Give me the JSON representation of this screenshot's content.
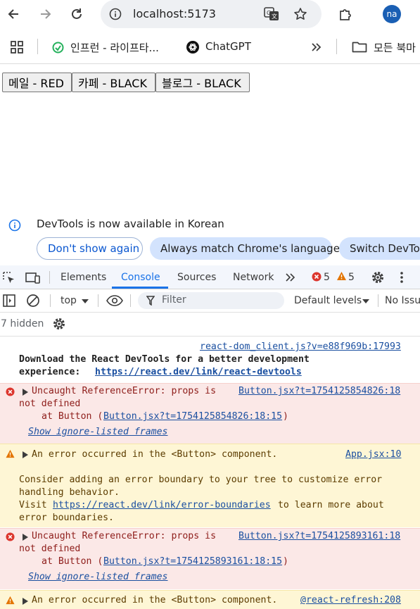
{
  "browser": {
    "url": "localhost:5173",
    "profile_initials": "na",
    "bookmarks": [
      {
        "label": "인프런 - 라이프타..."
      },
      {
        "label": "ChatGPT"
      },
      {
        "label": "모든 북마"
      }
    ]
  },
  "page": {
    "buttons": [
      {
        "label": "메일 - RED"
      },
      {
        "label": "카페 - BLACK"
      },
      {
        "label": "블로그 - BLACK"
      }
    ]
  },
  "devtools_notice": {
    "message": "DevTools is now available in Korean",
    "dont_show": "Don't show again",
    "always_match": "Always match Chrome's language",
    "switch": "Switch DevToo"
  },
  "devtools": {
    "tabs": [
      {
        "label": "Elements"
      },
      {
        "label": "Console"
      },
      {
        "label": "Sources"
      },
      {
        "label": "Network"
      }
    ],
    "error_count": "5",
    "warning_count": "5",
    "context": "top",
    "filter_placeholder": "Filter",
    "levels": "Default levels",
    "issues": "No Issu",
    "hidden": "7 hidden"
  },
  "console": {
    "info_source": "react-dom_client.js?v=e88f969b:17993",
    "info_line1": "Download the React DevTools for a better development",
    "info_line2_prefix": "experience: ",
    "info_link": "https://react.dev/link/react-devtools",
    "err1": {
      "line1": "Uncaught ReferenceError: props is",
      "line2": "not defined",
      "source": "Button.jsx?t=1754125854826:18",
      "at_prefix": "at Button (",
      "at_link": "Button.jsx?t=1754125854826:18:15",
      "at_suffix": ")",
      "ignore": "Show ignore-listed frames"
    },
    "warn1": {
      "line1": "An error occurred in the <Button> component.",
      "source": "App.jsx:10",
      "body1": "Consider adding an error boundary to your tree to customize error",
      "body2": "handling behavior.",
      "visit": "Visit ",
      "link": "https://react.dev/link/error-boundaries",
      "tail": " to learn more about",
      "body4": "error boundaries."
    },
    "err2": {
      "line1": "Uncaught ReferenceError: props is",
      "line2": "not defined",
      "source": "Button.jsx?t=1754125893161:18",
      "at_prefix": "at Button (",
      "at_link": "Button.jsx?t=1754125893161:18:15",
      "at_suffix": ")",
      "ignore": "Show ignore-listed frames"
    },
    "warn2": {
      "line1": "An error occurred in the <Button> component.",
      "source": "@react-refresh:208"
    }
  },
  "colors": {
    "accent": "#1a73e8",
    "error_bg": "#fbe8e7",
    "warning_bg": "#fef6d5",
    "error_icon": "#dc362e",
    "warning_icon": "#e37400"
  }
}
